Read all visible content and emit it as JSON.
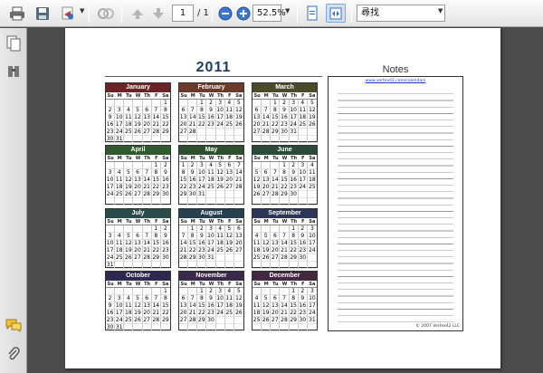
{
  "toolbar": {
    "page_current": "1",
    "page_total": "/ 1",
    "zoom": "52.5%",
    "search_value": "尋找",
    "icons": [
      "printer-icon",
      "save-icon",
      "email-icon",
      "collaborate-icon",
      "prev-page-icon",
      "next-page-icon",
      "zoom-out-icon",
      "zoom-in-icon",
      "fit-page-icon",
      "fit-width-icon"
    ]
  },
  "sidebar": {
    "icons": [
      "pages-icon",
      "bookmarks-icon",
      "comments-icon",
      "attachments-icon"
    ]
  },
  "document": {
    "year": "2011",
    "notes_title": "Notes",
    "notes_url": "www.vertex42.com/calendars",
    "copyright": "© 2007 Vertex42 LLC",
    "weekday_labels": [
      "Su",
      "M",
      "Tu",
      "W",
      "Th",
      "F",
      "Sa"
    ],
    "months": [
      {
        "name": "January",
        "color": "#6b2328",
        "start": 6,
        "days": 31
      },
      {
        "name": "February",
        "color": "#6b3a2a",
        "start": 2,
        "days": 28
      },
      {
        "name": "March",
        "color": "#4b4a2a",
        "start": 2,
        "days": 31
      },
      {
        "name": "April",
        "color": "#2f5a2f",
        "start": 5,
        "days": 30
      },
      {
        "name": "May",
        "color": "#2d4f2d",
        "start": 0,
        "days": 31
      },
      {
        "name": "June",
        "color": "#2c4a3a",
        "start": 3,
        "days": 30
      },
      {
        "name": "July",
        "color": "#2b4b4b",
        "start": 5,
        "days": 31
      },
      {
        "name": "August",
        "color": "#26404f",
        "start": 1,
        "days": 31
      },
      {
        "name": "September",
        "color": "#2b3556",
        "start": 4,
        "days": 30
      },
      {
        "name": "October",
        "color": "#2e2a4f",
        "start": 6,
        "days": 31
      },
      {
        "name": "November",
        "color": "#3a2a4a",
        "start": 2,
        "days": 30
      },
      {
        "name": "December",
        "color": "#44283f",
        "start": 4,
        "days": 31
      }
    ]
  }
}
